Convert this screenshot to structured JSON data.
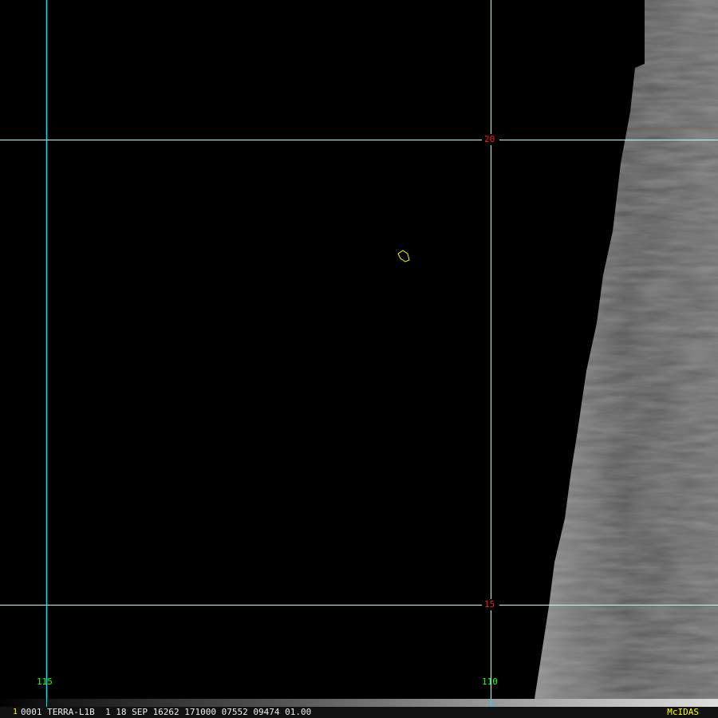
{
  "grid_labels": {
    "lat_20": "20",
    "lat_15": "15",
    "lon_115": "115",
    "lon_110": "110"
  },
  "status": {
    "frame_number": "1",
    "info": "0001 TERRA-L1B  1 18 SEP 16262 171000 07552 09474 01.00",
    "brand": "McIDAS"
  },
  "colors": {
    "grid": "#00e5ee",
    "lat_label": "#ff2020",
    "lon_label": "#20ff20",
    "coastline": "#ffff00",
    "brand": "#ffff00"
  }
}
